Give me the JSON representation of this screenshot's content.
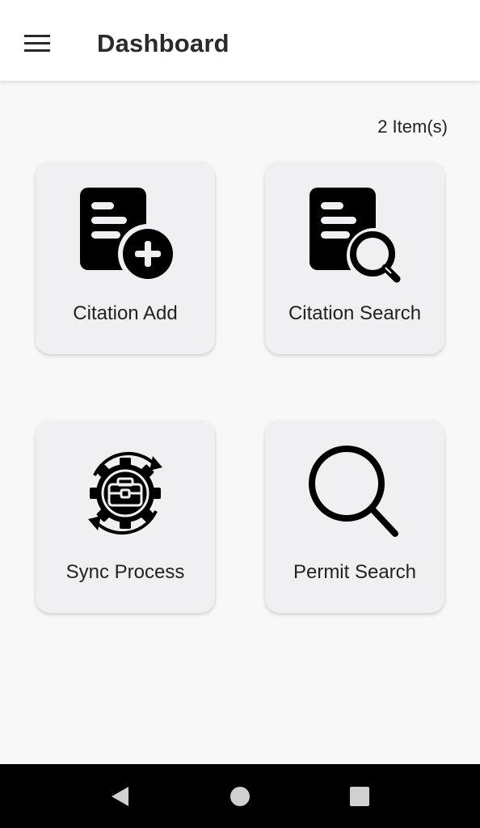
{
  "header": {
    "title": "Dashboard",
    "menu_icon": "hamburger-menu-icon"
  },
  "main": {
    "item_count": "2 Item(s)",
    "tiles": [
      {
        "label": "Citation Add",
        "icon": "document-add-icon"
      },
      {
        "label": "Citation Search",
        "icon": "document-search-icon"
      },
      {
        "label": "Sync Process",
        "icon": "gear-sync-icon"
      },
      {
        "label": "Permit Search",
        "icon": "search-icon"
      }
    ]
  },
  "nav_bar": {
    "buttons": [
      "back-icon",
      "home-icon",
      "recents-icon"
    ]
  },
  "colors": {
    "app_bar": "#ffffff",
    "background": "#f8f8f8",
    "tile": "#f0f0f2",
    "nav_bar": "#000000",
    "icon": "#000000"
  }
}
